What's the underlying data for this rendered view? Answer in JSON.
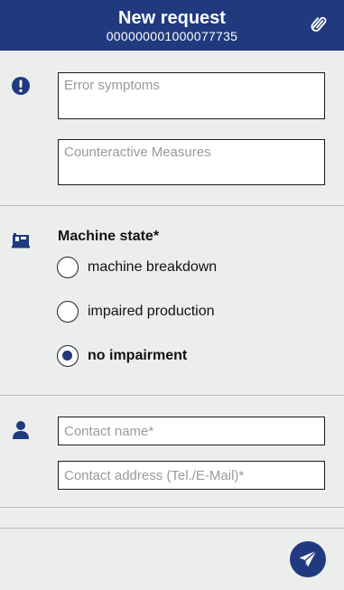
{
  "header": {
    "title": "New request",
    "request_number": "000000001000077735",
    "attach_icon": "paperclip-icon"
  },
  "problem_section": {
    "icon": "exclamation-circle-icon",
    "error_symptoms": {
      "placeholder": "Error symptoms",
      "value": ""
    },
    "counteractive_measures": {
      "placeholder": "Counteractive Measures",
      "value": ""
    }
  },
  "machine_section": {
    "icon": "machine-icon",
    "label": "Machine state*",
    "options": [
      {
        "label": "machine breakdown",
        "selected": false
      },
      {
        "label": "impaired production",
        "selected": false
      },
      {
        "label": "no impairment",
        "selected": true
      }
    ]
  },
  "contact_section": {
    "icon": "person-icon",
    "contact_name": {
      "placeholder": "Contact name*",
      "value": ""
    },
    "contact_address": {
      "placeholder": "Contact address (Tel./E-Mail)*",
      "value": ""
    }
  },
  "footer": {
    "send_icon": "paper-plane-icon"
  },
  "colors": {
    "brand": "#213a7f",
    "background": "#eceeee",
    "divider": "#b7b9bb"
  }
}
